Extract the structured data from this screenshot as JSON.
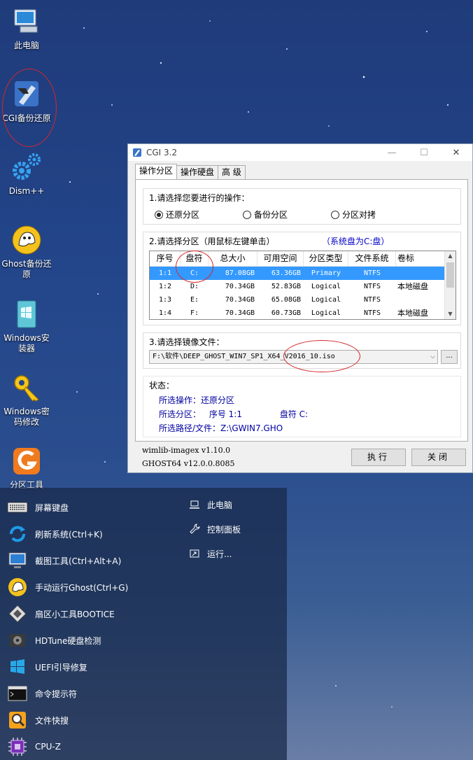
{
  "desktop_icons": [
    {
      "id": "this-pc",
      "label": "此电脑"
    },
    {
      "id": "cgi",
      "label": "CGI备份还原"
    },
    {
      "id": "dism",
      "label": "Dism++"
    },
    {
      "id": "ghost",
      "label": "Ghost备份还原"
    },
    {
      "id": "win-installer",
      "label": "Windows安装器"
    },
    {
      "id": "win-password",
      "label": "Windows密码修改"
    },
    {
      "id": "partition-tool",
      "label": "分区工具"
    }
  ],
  "window": {
    "title": "CGI 3.2",
    "tabs": [
      "操作分区",
      "操作硬盘",
      "高 级"
    ],
    "section1": {
      "title": "1.请选择您要进行的操作：",
      "options": [
        "还原分区",
        "备份分区",
        "分区对拷"
      ],
      "selected": "还原分区"
    },
    "section2": {
      "title": "2.请选择分区（用鼠标左键单击）",
      "note": "（系统盘为C:盘）",
      "columns": [
        "序号",
        "盘符",
        "总大小",
        "可用空间",
        "分区类型",
        "文件系统",
        "卷标"
      ],
      "rows": [
        [
          "1:1",
          "C:",
          "87.08GB",
          "63.36GB",
          "Primary",
          "NTFS",
          ""
        ],
        [
          "1:2",
          "D:",
          "70.34GB",
          "52.83GB",
          "Logical",
          "NTFS",
          "本地磁盘"
        ],
        [
          "1:3",
          "E:",
          "70.34GB",
          "65.08GB",
          "Logical",
          "NTFS",
          ""
        ],
        [
          "1:4",
          "F:",
          "70.34GB",
          "60.73GB",
          "Logical",
          "NTFS",
          "本地磁盘"
        ]
      ],
      "selected_row": 0
    },
    "section3": {
      "title": "3.请选择镜像文件：",
      "image_path": "F:\\软件\\DEEP_GHOST_WIN7_SP1_X64_V2016_10.iso",
      "browse_label": "..."
    },
    "status": {
      "title": "状态：",
      "operation": "所选操作：还原分区",
      "partition_label": "所选分区：",
      "partition_index": "序号 1:1",
      "partition_drive": "盘符 C:",
      "path": "所选路径/文件：Z:\\GWIN7.GHO"
    },
    "versions": [
      "wimlib-imagex v1.10.0",
      "GHOST64 v12.0.0.8085"
    ],
    "buttons": {
      "execute": "执行",
      "close": "关闭"
    }
  },
  "start_menu": {
    "left_items": [
      {
        "icon": "keyboard-icon",
        "label": "屏幕键盘"
      },
      {
        "icon": "refresh-icon",
        "label": "刷新系统(Ctrl+K)"
      },
      {
        "icon": "monitor-icon",
        "label": "截图工具(Ctrl+Alt+A)"
      },
      {
        "icon": "ghost-icon",
        "label": "手动运行Ghost(Ctrl+G)"
      },
      {
        "icon": "bootice-icon",
        "label": "扇区小工具BOOTICE"
      },
      {
        "icon": "hdtune-icon",
        "label": "HDTune硬盘检测"
      },
      {
        "icon": "uefi-icon",
        "label": "UEFI引导修复"
      },
      {
        "icon": "terminal-icon",
        "label": "命令提示符"
      },
      {
        "icon": "search-icon",
        "label": "文件快搜"
      },
      {
        "icon": "cpu-icon",
        "label": "CPU-Z"
      }
    ],
    "right_items": [
      {
        "icon": "laptop-icon",
        "label": "此电脑"
      },
      {
        "icon": "wrench-icon",
        "label": "控制面板"
      },
      {
        "icon": "run-icon",
        "label": "运行..."
      }
    ]
  }
}
